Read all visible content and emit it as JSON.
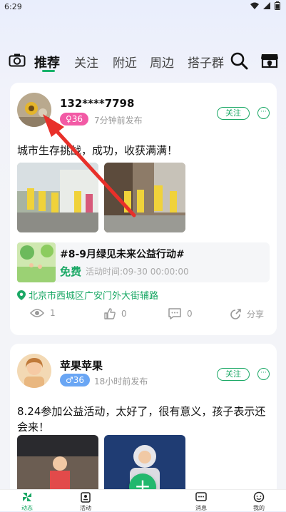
{
  "status_bar": {
    "time": "6:29"
  },
  "nav": {
    "tabs": [
      "推荐",
      "关注",
      "附近",
      "周边",
      "搭子群"
    ],
    "active_tab": "推荐"
  },
  "posts": [
    {
      "username": "132****7798",
      "badge": "♀36",
      "badge_color": "#f25aa5",
      "time": "7分钟前发布",
      "follow": "关注",
      "more": "···",
      "text": "城市生存挑战，成功，收获满满！",
      "event": {
        "title": "#8-9月绿见未来公益行动#",
        "price": "免费",
        "time": "活动时间:09-30 00:00:00"
      },
      "location": "北京市西城区广安门外大街辅路",
      "views": "1",
      "likes": "0",
      "comments": "0",
      "share": "分享"
    },
    {
      "username": "苹果苹果",
      "badge": "♂36",
      "badge_color": "#6aa6f4",
      "time": "18小时前发布",
      "follow": "关注",
      "more": "···",
      "text": "8.24参加公益活动，太好了，很有意义，孩子表示还会来！"
    }
  ],
  "bottom_nav": {
    "items": [
      "动态",
      "活动",
      "消息",
      "我的"
    ],
    "fab": "+"
  },
  "colors": {
    "accent": "#1aa865",
    "fab": "#22b86e"
  }
}
